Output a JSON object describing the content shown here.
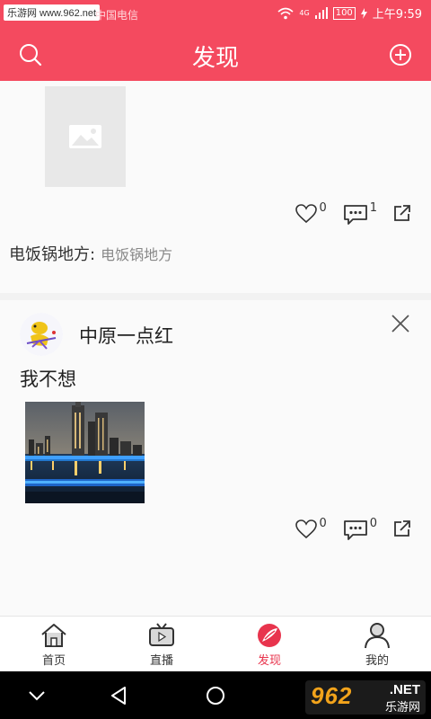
{
  "status_bar": {
    "watermark": "乐游网 www.962.net",
    "watermark_tail": "中国电信",
    "signal_label": "4G",
    "battery": "100",
    "time": "上午9:59"
  },
  "header": {
    "title": "发现",
    "left_icon": "search-icon",
    "right_icon": "add-circle-icon",
    "bg_color": "#f44a5f"
  },
  "posts": [
    {
      "image": "placeholder-image",
      "likes": "0",
      "comments": "1",
      "meta_label": "电饭锅地方:",
      "meta_value": "电饭锅地方"
    },
    {
      "author": "中原一点红",
      "text": "我不想",
      "image": "city-night-photo",
      "likes": "0",
      "comments": "0"
    }
  ],
  "tabs": [
    {
      "label": "首页",
      "icon": "home-icon"
    },
    {
      "label": "直播",
      "icon": "tv-icon"
    },
    {
      "label": "发现",
      "icon": "discover-icon",
      "active": true
    },
    {
      "label": "我的",
      "icon": "profile-icon"
    }
  ],
  "watermark_logo": {
    "number": "962",
    "net": ".NET",
    "sub": "乐游网"
  },
  "accent_color": "#e8344d"
}
